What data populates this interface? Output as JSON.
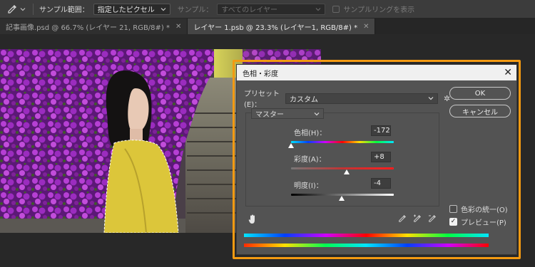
{
  "options_bar": {
    "sample_range_label": "サンプル範囲：",
    "sample_range_value": "指定したピクセル",
    "sample_label": "サンプル：",
    "sample_value": "すべてのレイヤー",
    "sampling_ring_label": "サンプルリングを表示"
  },
  "tabs": [
    {
      "label": "記事画像.psd @ 66.7% (レイヤー 21, RGB/8#) *"
    },
    {
      "label": "レイヤー 1.psb @ 23.3% (レイヤー1, RGB/8#) *"
    }
  ],
  "dialog": {
    "title": "色相・彩度",
    "preset_label": "プリセット(E)：",
    "preset_value": "カスタム",
    "ok_label": "OK",
    "cancel_label": "キャンセル",
    "channel_value": "マスター",
    "hue": {
      "label": "色相(H)：",
      "value": "-172",
      "position": 0.0
    },
    "saturation": {
      "label": "彩度(A)：",
      "value": "+8",
      "position": 0.54
    },
    "lightness": {
      "label": "明度(I)：",
      "value": "-4",
      "position": 0.49
    },
    "colorize_label": "色彩の統一(O)",
    "colorize_checked": false,
    "preview_label": "プレビュー(P)",
    "preview_checked": true
  },
  "colors": {
    "highlight": "#f39a12",
    "dialog_bg": "#535353",
    "titlebar_bg": "#f0f0f0"
  }
}
